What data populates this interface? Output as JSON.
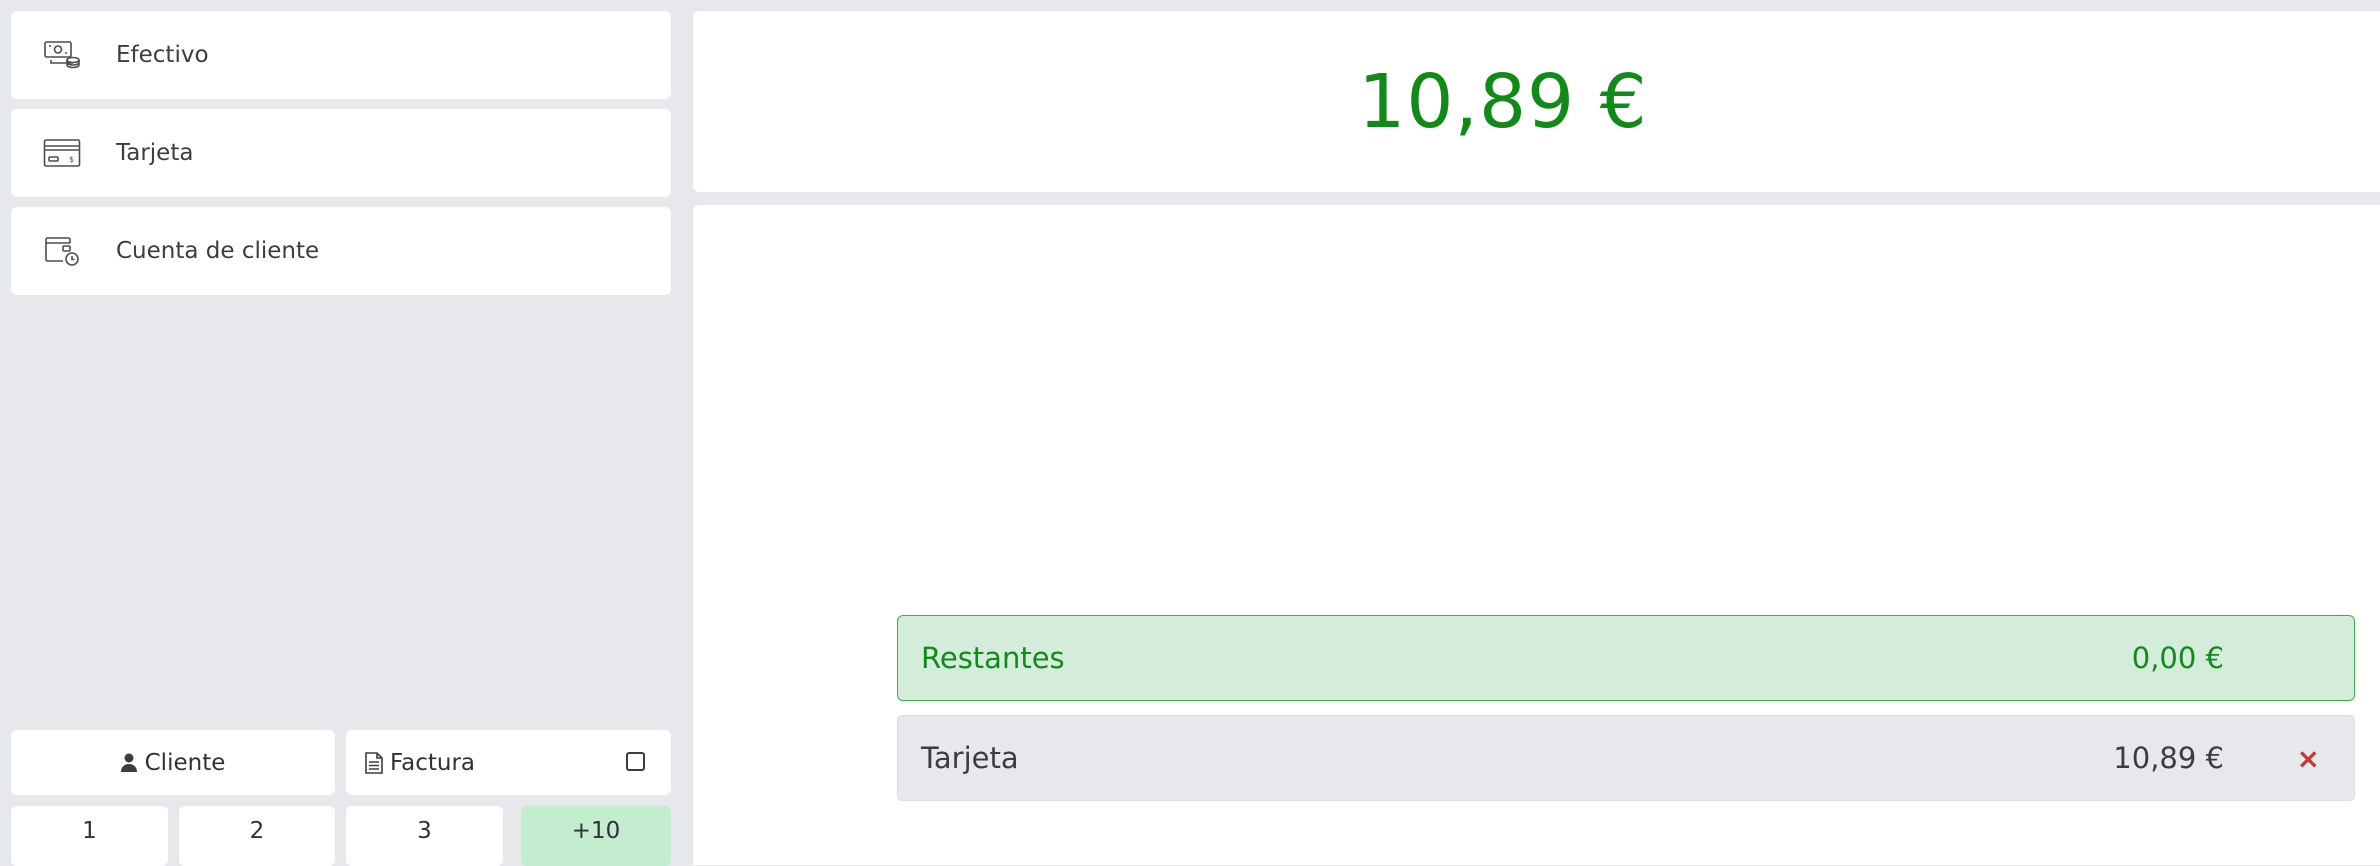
{
  "payment_methods": [
    {
      "label": "Efectivo",
      "icon": "cash-icon"
    },
    {
      "label": "Tarjeta",
      "icon": "credit-card-icon"
    },
    {
      "label": "Cuenta de cliente",
      "icon": "customer-account-icon"
    }
  ],
  "total": {
    "amount": "10,89 €",
    "color": "#118b17"
  },
  "payments": {
    "remaining": {
      "label": "Restantes",
      "amount": "0,00 €"
    },
    "lines": [
      {
        "label": "Tarjeta",
        "amount": "10,89 €",
        "remove": "×"
      }
    ]
  },
  "actions": {
    "customer_label": "Cliente",
    "invoice_label": "Factura",
    "invoice_checked": false
  },
  "keypad": [
    "1",
    "2",
    "3",
    "+10"
  ],
  "colors": {
    "accent_green": "#118b17",
    "remaining_bg": "#d4edda",
    "keypad_highlight": "#c4ecce",
    "remove_red": "#d5312d",
    "background": "#e7e8ec"
  }
}
